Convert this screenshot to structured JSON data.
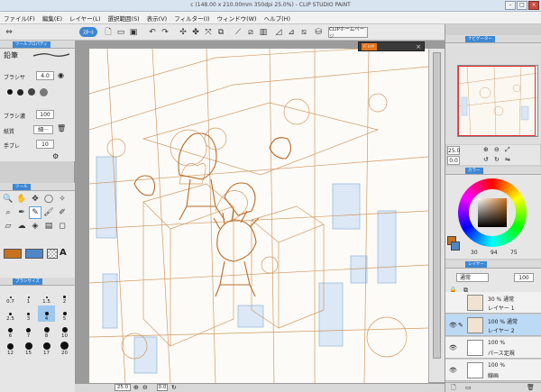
{
  "window": {
    "title": "c (148.00 x 210.00mm 350dpi 25.0%)  - CLIP STUDIO PAINT"
  },
  "menu": [
    "ファイル(F)",
    "編集(E)",
    "レイヤー(L)",
    "選択範囲(S)",
    "表示(V)",
    "フィルター(I)",
    "ウィンドウ(W)",
    "ヘルプ(H)"
  ],
  "toolbar": {
    "new_label": "ｽﾀｰﾄ",
    "clip_home_label": "CLIPホームページ"
  },
  "tool_property": {
    "tab_label": "ツールプロパティ",
    "tool_name": "鉛筆",
    "brush_size_label": "ブラシサ",
    "brush_size_value": "4.0",
    "aa_label": "アンチエイリアス",
    "density_label": "ブラシ濃",
    "density_value": "100",
    "paper_label": "紙質",
    "paper_value": "細···",
    "correction_label": "手ブレ",
    "correction_value": "10"
  },
  "tool_palette": {
    "tab_label": "ツール"
  },
  "brush_size_palette": {
    "tab_label": "ブラシサイズ",
    "sizes": [
      "0.7",
      "1",
      "1.5",
      "2",
      "2.5",
      "3",
      "4",
      "5",
      "6",
      "7",
      "8",
      "10",
      "12",
      "15",
      "17",
      "20"
    ],
    "selected": "4"
  },
  "canvas": {
    "zoom": "25.0",
    "angle": "0.0"
  },
  "subview": {
    "tag": "ﾊﾟﾚｯﾄ"
  },
  "navigator": {
    "tab_label": "ナビゲーター",
    "zoom": "25.0",
    "angle": "0.0"
  },
  "color_panel": {
    "tab_label": "カラー",
    "h": "30",
    "s": "94",
    "v": "75"
  },
  "layer_panel": {
    "tab_label": "レイヤー",
    "blend_mode": "通常",
    "opacity": "100",
    "layers": [
      {
        "opacity_mode": "30 %  通常",
        "name": "レイヤー 1"
      },
      {
        "opacity_mode": "100 %  通常",
        "name": "レイヤー 2"
      },
      {
        "opacity_mode": "100 %",
        "name": "パース定規"
      },
      {
        "opacity_mode": "100 %",
        "name": "線画"
      }
    ]
  },
  "colors": {
    "accent": "#3d87d4",
    "main_color": "#c8711f",
    "sub_color": "#4f86c6",
    "sketch": "#c98a4b",
    "sketch_blue": "#8fb3de"
  }
}
